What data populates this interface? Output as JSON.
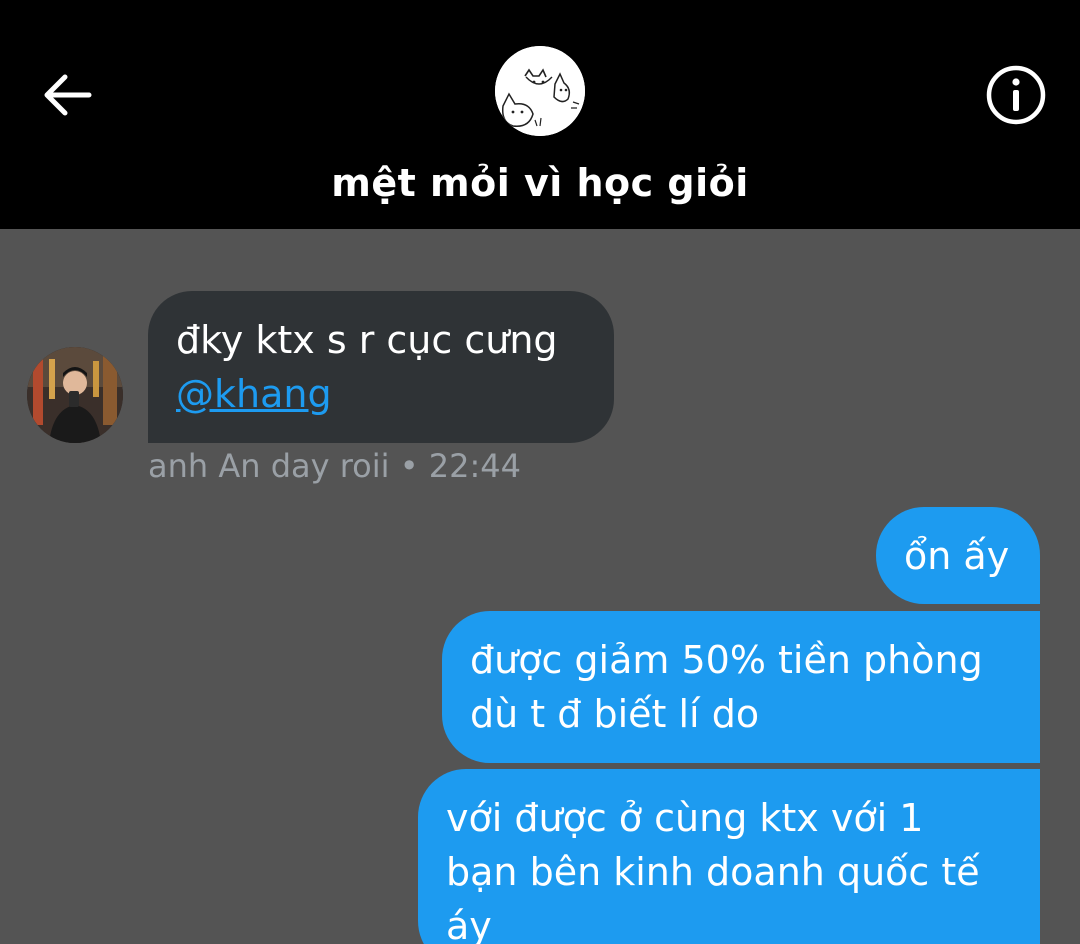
{
  "header": {
    "title": "mệt mỏi vì học giỏi",
    "back_icon": "arrow-left-icon",
    "info_icon": "info-circle-icon",
    "avatar": "group-avatar-cats"
  },
  "messages": {
    "incoming": {
      "text": "đky ktx s r cục cưng",
      "mention": "@khang",
      "sender": "anh An day roii",
      "separator": "•",
      "time": "22:44"
    },
    "outgoing": [
      {
        "lines": [
          "ổn ấy"
        ]
      },
      {
        "lines": [
          "được giảm 50% tiền phòng",
          "dù t đ biết lí do"
        ]
      },
      {
        "lines": [
          "với được ở cùng ktx với 1",
          "bạn bên kinh doanh quốc tế",
          "áy"
        ]
      }
    ]
  },
  "colors": {
    "header_bg": "#000000",
    "chat_bg": "#545454",
    "incoming_bubble": "#2f3336",
    "outgoing_bubble": "#1d9bf0",
    "mention": "#1d9bf0",
    "meta_text": "#9aa0a6"
  }
}
